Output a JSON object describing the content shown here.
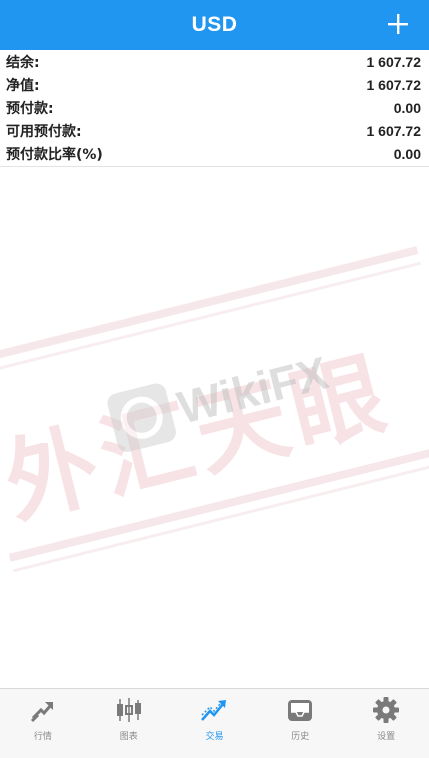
{
  "header": {
    "title": "USD",
    "add_icon": "plus-icon",
    "bg_color": "#2196f0"
  },
  "summary": [
    {
      "label": "结余:",
      "value": "1 607.72"
    },
    {
      "label": "净值:",
      "value": "1 607.72"
    },
    {
      "label": "预付款:",
      "value": "0.00"
    },
    {
      "label": "可用预付款:",
      "value": "1 607.72"
    },
    {
      "label": "预付款比率(%)",
      "value": "0.00"
    }
  ],
  "watermark": {
    "brand": "WikiFX",
    "chinese": "外汇天眼"
  },
  "tabs": [
    {
      "label": "行情",
      "icon": "quotes-arrow-icon",
      "active": false
    },
    {
      "label": "图表",
      "icon": "candlestick-chart-icon",
      "active": false
    },
    {
      "label": "交易",
      "icon": "trade-trend-icon",
      "active": true
    },
    {
      "label": "历史",
      "icon": "history-inbox-icon",
      "active": false
    },
    {
      "label": "设置",
      "icon": "settings-gear-icon",
      "active": false
    }
  ],
  "colors": {
    "accent": "#2196f0",
    "inactive_icon": "#7a7a7a"
  }
}
